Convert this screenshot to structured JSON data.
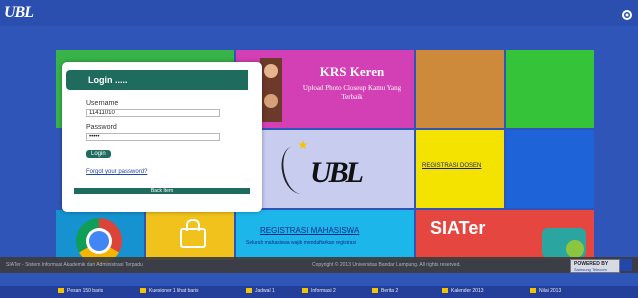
{
  "header": {
    "logo_text": "UBL"
  },
  "login": {
    "title": "Login .....",
    "username_label": "Username",
    "username_value": "11411010",
    "password_label": "Password",
    "password_value": "•••••",
    "login_button": "Login",
    "forgot_link": "Forgot your password?",
    "back_button": "Back Item"
  },
  "tiles": {
    "krs_title": "KRS Keren",
    "krs_subtitle": "Upload Photo Closeup Kamu Yang Terbaik",
    "ubl_logo": "UBL",
    "regdosen": "REGISTRASI DOSEN",
    "regmhs": "REGISTRASI MAHASISWA",
    "regmhs_sub": "Seluruh mahasiswa wajib mendaftarkan registrasi",
    "siater": "SIATer"
  },
  "footer": {
    "left": "SIATer - Sistem Informasi Akademik dan Administrasi Terpadu",
    "right": "Copyright © 2013 Universitas Bandar Lampung. All rights reserved.",
    "powered_line1": "POWERED BY",
    "powered_line2": "Samsung Telecom"
  },
  "taskbar": {
    "items": [
      "Pesan 150 baris",
      "Kuesioner 1 lihat baris",
      "Jadwal 1",
      "Informasi 2",
      "Berita 2",
      "Kalender 2013",
      "Nilai 2013"
    ]
  },
  "colors": {
    "background": "#2f55b8",
    "login_header": "#1f6b5e"
  }
}
